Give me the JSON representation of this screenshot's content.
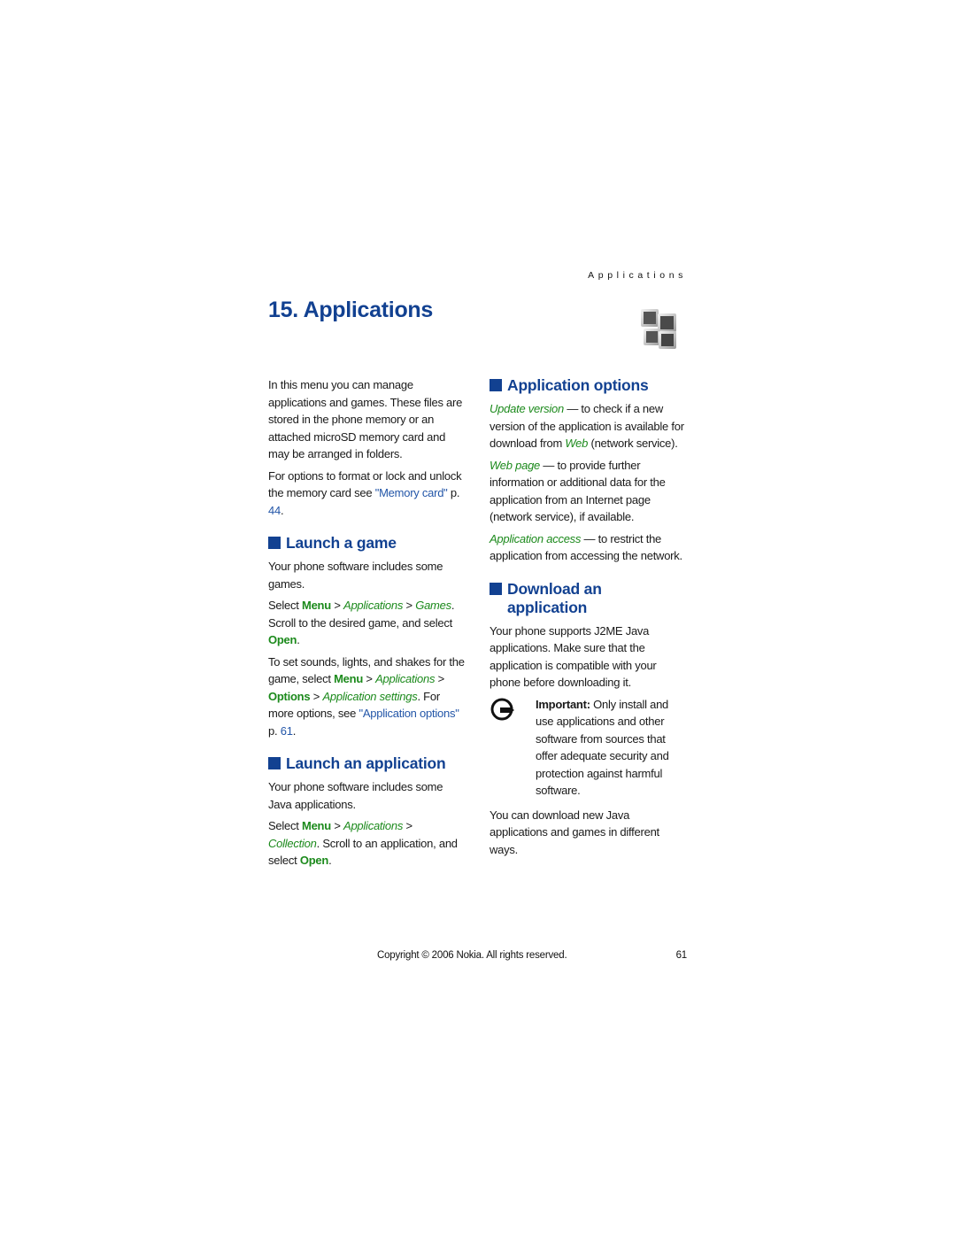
{
  "header": {
    "running_head": "Applications",
    "chapter_title": "15. Applications",
    "chapter_icon": "applications-cubes-icon"
  },
  "left_column": {
    "intro": "In this menu you can manage applications and games. These files are stored in the phone memory or an attached microSD memory card and may be arranged in folders.",
    "memory_para": {
      "text": "For options to format or lock and unlock the memory card see ",
      "link": "\"Memory card\"",
      "page_prefix": " p. ",
      "page": "44",
      "end": "."
    },
    "launch_game": {
      "heading": "Launch a game",
      "p1": "Your phone software includes some games.",
      "p2": {
        "select": "Select ",
        "menu": "Menu",
        "sep1": " > ",
        "applications": "Applications",
        "sep2": " > ",
        "games": "Games",
        "rest": ". Scroll to the desired game, and select ",
        "open": "Open",
        "end": "."
      },
      "p3": {
        "t1": "To set sounds, lights, and shakes for the game, select ",
        "menu": "Menu",
        "sep1": " > ",
        "applications": "Applications",
        "sep2": " > ",
        "options": "Options",
        "sep3": " > ",
        "app_settings": "Application settings",
        "t2": ". For more options, see ",
        "link": "\"Application options\"",
        "page_prefix": " p. ",
        "page": "61",
        "end": "."
      }
    },
    "launch_app": {
      "heading": "Launch an application",
      "p1": "Your phone software includes some Java applications.",
      "p2": {
        "select": "Select ",
        "menu": "Menu",
        "sep1": " > ",
        "applications": "Applications",
        "sep2": " > ",
        "collection": "Collection",
        "rest": ". Scroll to an application, and select ",
        "open": "Open",
        "end": "."
      }
    }
  },
  "right_column": {
    "app_options": {
      "heading": "Application options",
      "items": [
        {
          "term": "Update version",
          "desc1": " — to check if a new version of the application is available for download from ",
          "web": "Web",
          "desc2": " (network service)."
        },
        {
          "term": "Web page",
          "desc": " — to provide further information or additional data for the application from an Internet page (network service), if available."
        },
        {
          "term": "Application access",
          "desc": " — to restrict the application from accessing the network."
        }
      ]
    },
    "download": {
      "heading": "Download an application",
      "p1": "Your phone supports J2ME Java applications. Make sure that the application is compatible with your phone before downloading it.",
      "note": {
        "icon": "important-hand-icon",
        "label": "Important:",
        "text": " Only install and use applications and other software from sources that offer adequate security and protection against harmful software."
      },
      "p2": "You can download new Java applications and games in different ways."
    }
  },
  "footer": {
    "copyright": "Copyright © 2006 Nokia. All rights reserved.",
    "page_number": "61"
  },
  "colors": {
    "heading_blue": "#124191",
    "menu_green": "#1c8a1c",
    "link_blue": "#2356a8"
  }
}
